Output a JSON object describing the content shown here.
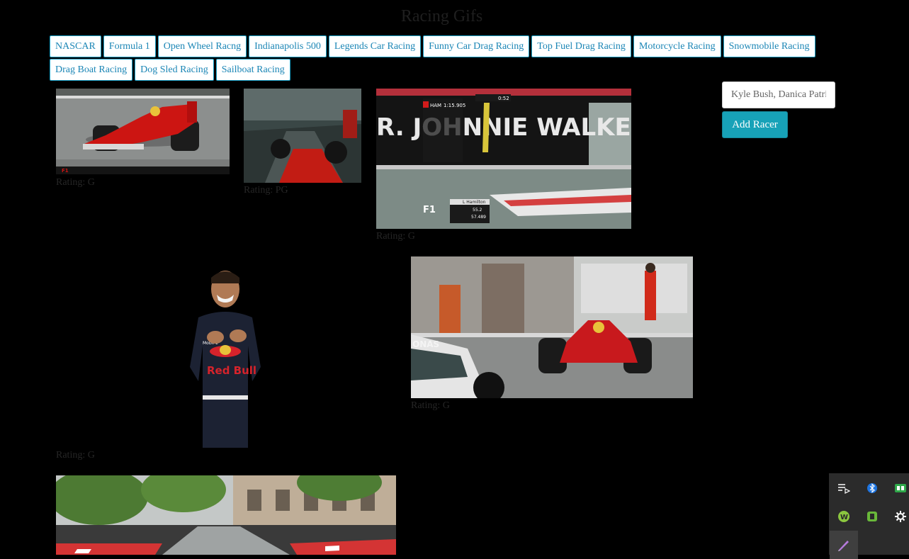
{
  "page": {
    "title": "Racing Gifs"
  },
  "categories": [
    "NASCAR",
    "Formula 1",
    "Open Wheel Racng",
    "Indianapolis 500",
    "Legends Car Racing",
    "Funny Car Drag Racing",
    "Top Fuel Drag Racing",
    "Motorcycle Racing",
    "Snowmobile Racing",
    "Drag Boat Racing",
    "Dog Sled Racing",
    "Sailboat Racing"
  ],
  "gifs": [
    {
      "rating": "Rating: G",
      "overlay": [
        "F1"
      ]
    },
    {
      "rating": "Rating: PG"
    },
    {
      "rating": "Rating: G",
      "overlay": [
        "R. JOHNNIE WALKER.",
        "HAM",
        "1:15.905",
        "0:52",
        "L Hamilton",
        "55.2",
        "57.489",
        "F1"
      ]
    },
    {
      "rating": "Rating: G",
      "overlay": [
        "Red Bull",
        "Mobil 1"
      ]
    },
    {
      "rating": "Rating: G",
      "overlay": [
        "ONAS"
      ]
    },
    {
      "rating": ""
    }
  ],
  "racer_form": {
    "placeholder": "Kyle Bush, Danica Patrick",
    "button_label": "Add Racer"
  },
  "tray": {
    "icons": [
      "queue-icon",
      "bluetooth-icon",
      "meet-icon",
      "whatsapp-icon",
      "evernote-icon",
      "settings-icon",
      "pen-icon"
    ]
  },
  "colors": {
    "background": "#000000",
    "button_text": "#1b86b6",
    "button_border": "#1aa0c6",
    "add_button": "#17a2b8",
    "rating_text": "#262626",
    "title_text": "#1f1f1f"
  }
}
